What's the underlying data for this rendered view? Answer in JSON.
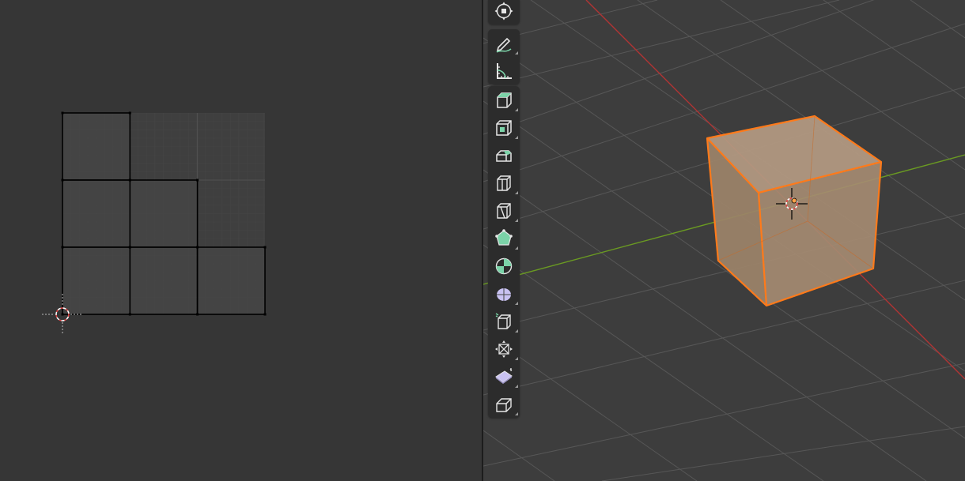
{
  "editors": {
    "left": {
      "type": "UV Editor",
      "background": "#363636"
    },
    "right": {
      "type": "3D Viewport",
      "background": "#3d3d3d"
    }
  },
  "uv_editor": {
    "grid_color": "#4a4a4a",
    "island_edge_color": "#000000",
    "vertex_color": "#000000",
    "cursor_icon": "2d-cursor-icon"
  },
  "viewport": {
    "x_axis_color": "#b03434",
    "y_axis_color": "#6a9a22",
    "grid_color": "#5a5a5a",
    "selected_object": "Cube",
    "selection_outline": "#ff7a1a",
    "object_fill": "#a68c72",
    "cursor_icon": "3d-cursor-icon",
    "origin_icon": "object-origin-icon"
  },
  "toolbar": {
    "groups": [
      [
        {
          "icon": "transform-tool-icon",
          "has_submenu": false
        }
      ],
      [
        {
          "icon": "annotate-tool-icon",
          "has_submenu": true
        },
        {
          "icon": "measure-tool-icon",
          "has_submenu": false
        }
      ],
      [
        {
          "icon": "add-cube-tool-icon",
          "has_submenu": true
        },
        {
          "icon": "extrude-region-tool-icon",
          "has_submenu": true
        },
        {
          "icon": "inset-faces-tool-icon",
          "has_submenu": false
        },
        {
          "icon": "bevel-tool-icon",
          "has_submenu": true
        },
        {
          "icon": "loop-cut-tool-icon",
          "has_submenu": true
        },
        {
          "icon": "knife-tool-icon",
          "has_submenu": true
        },
        {
          "icon": "poly-build-tool-icon",
          "has_submenu": false
        },
        {
          "icon": "spin-tool-icon",
          "has_submenu": true
        },
        {
          "icon": "smooth-tool-icon",
          "has_submenu": true
        },
        {
          "icon": "edge-slide-tool-icon",
          "has_submenu": true
        },
        {
          "icon": "shrink-fatten-tool-icon",
          "has_submenu": true
        },
        {
          "icon": "shear-tool-icon",
          "has_submenu": true
        },
        {
          "icon": "rip-region-tool-icon",
          "has_submenu": true
        }
      ]
    ],
    "accent_green": "#7bd3a8",
    "accent_purple": "#c9c2f2"
  }
}
